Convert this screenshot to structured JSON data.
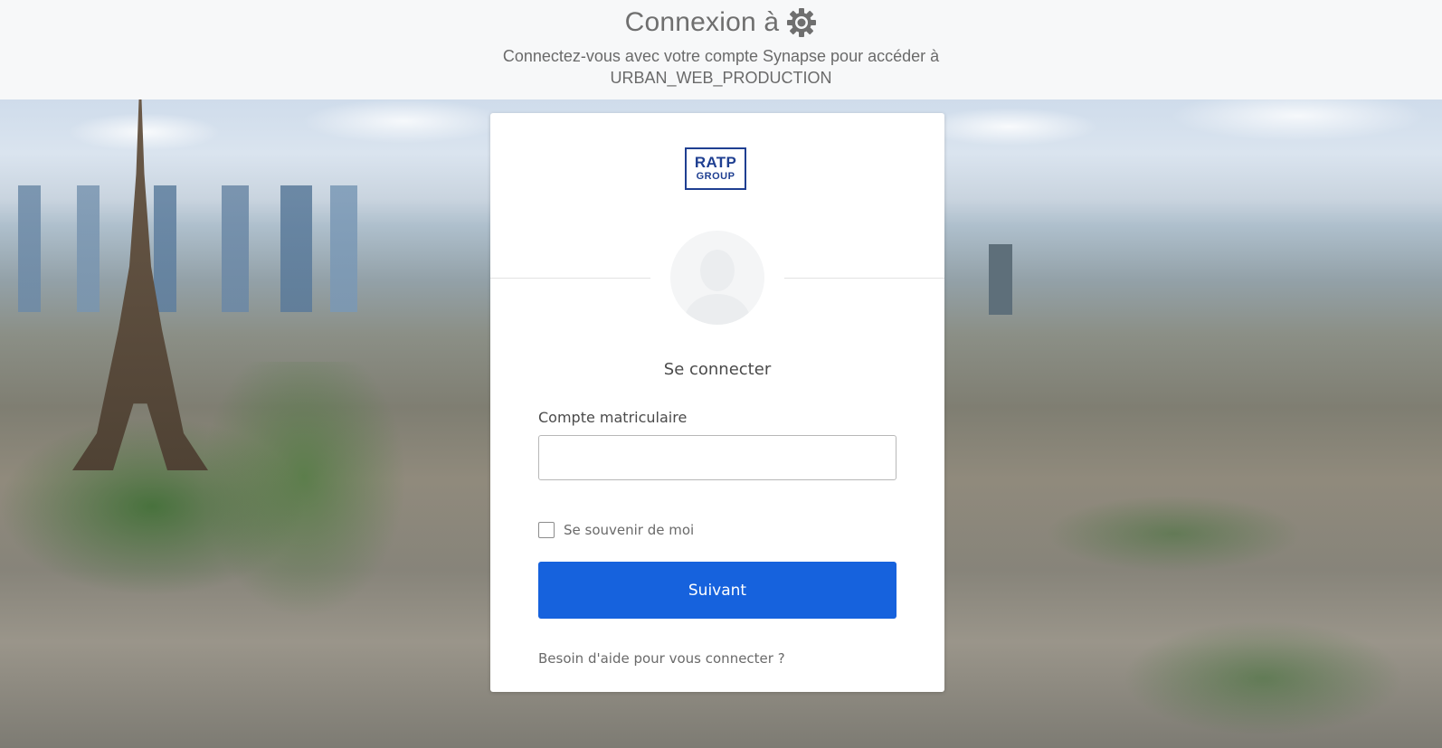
{
  "header": {
    "title": "Connexion à",
    "title_icon": "gear-icon",
    "subtitle_line1": "Connectez-vous avec votre compte Synapse pour accéder à",
    "subtitle_line2": "URBAN_WEB_PRODUCTION"
  },
  "card": {
    "logo": {
      "line1": "RATP",
      "line2": "GROUP",
      "color": "#1f3f91"
    },
    "avatar_icon": "user-silhouette-icon",
    "heading": "Se connecter",
    "username": {
      "label": "Compte matriculaire",
      "value": "",
      "placeholder": ""
    },
    "remember_me": {
      "label": "Se souvenir de moi",
      "checked": false
    },
    "submit_label": "Suivant",
    "help_link": "Besoin d'aide pour vous connecter ?"
  },
  "colors": {
    "primary_button": "#1662dd",
    "header_background": "#f7f8f9",
    "card_background": "#ffffff"
  }
}
